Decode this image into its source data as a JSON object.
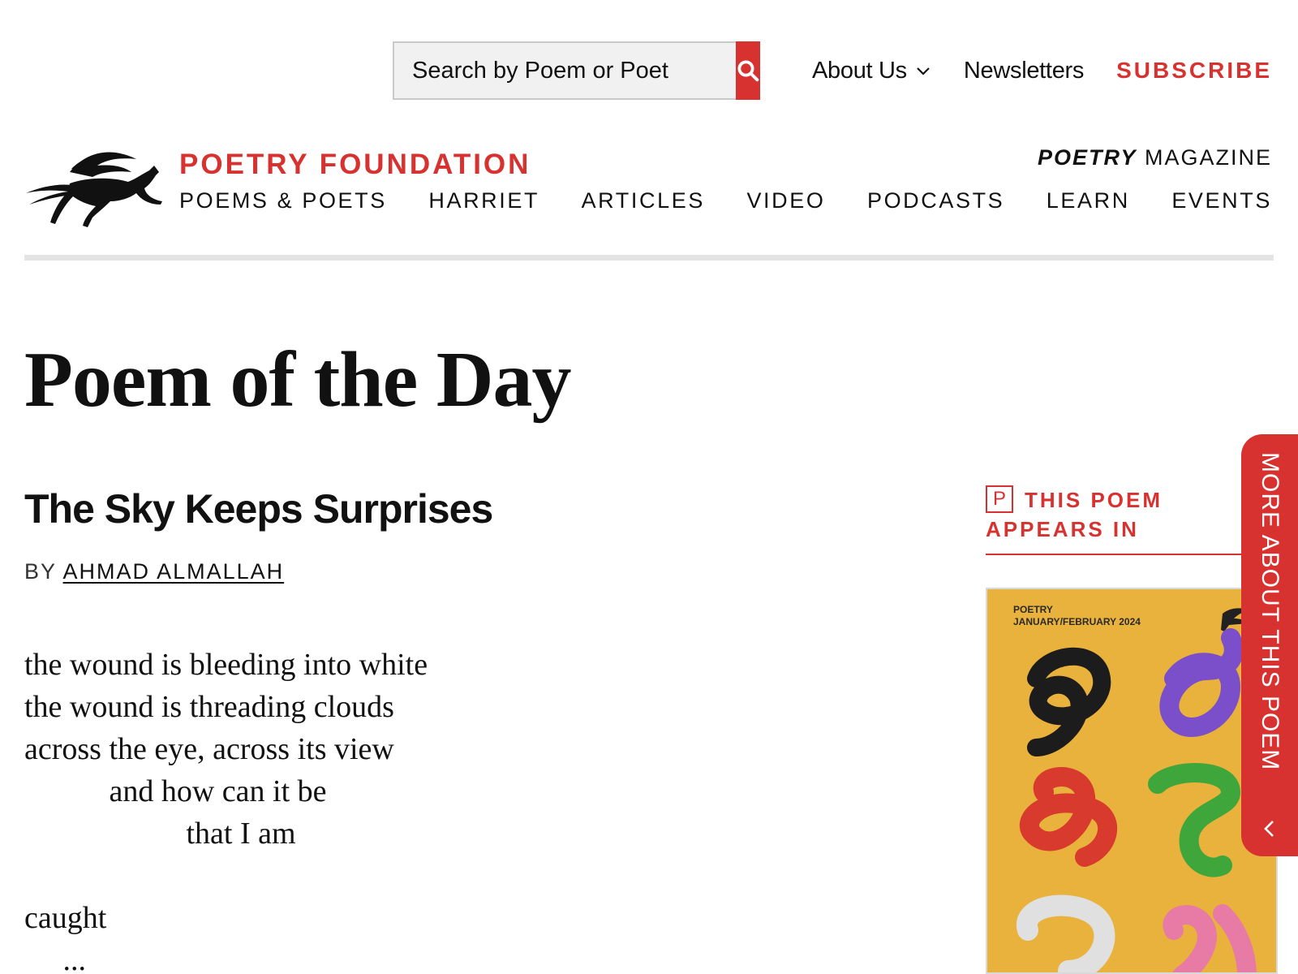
{
  "header": {
    "search": {
      "placeholder": "Search by Poem or Poet"
    },
    "top_links": {
      "about": "About Us",
      "newsletters": "Newsletters",
      "subscribe": "SUBSCRIBE"
    },
    "brand": "POETRY FOUNDATION",
    "magazine": {
      "bold": "POETRY",
      "rest": " MAGAZINE"
    },
    "nav": [
      "POEMS & POETS",
      "HARRIET",
      "ARTICLES",
      "VIDEO",
      "PODCASTS",
      "LEARN",
      "EVENTS"
    ]
  },
  "page": {
    "title": "Poem of the Day",
    "poem_title": "The Sky Keeps Surprises",
    "by_prefix": "BY ",
    "author": "AHMAD ALMALLAH",
    "lines": [
      "the wound is bleeding into white",
      "the wound is threading clouds",
      "across the eye, across its view",
      "           and how can it be",
      "                     that I am",
      "",
      "caught",
      "     ..."
    ]
  },
  "sidebar": {
    "p_icon": "P",
    "appears_in": "THIS POEM APPEARS IN",
    "cover": {
      "line1": "POETRY",
      "line2": "JANUARY/FEBRUARY 2024"
    },
    "more_tab": "MORE ABOUT THIS POEM"
  },
  "colors": {
    "accent": "#d73230",
    "cover_bg": "#e8b23c",
    "text": "#111111"
  },
  "icons": [
    "search-icon",
    "chevron-down-icon",
    "pegasus-logo-icon",
    "p-icon",
    "chevron-left-icon"
  ]
}
